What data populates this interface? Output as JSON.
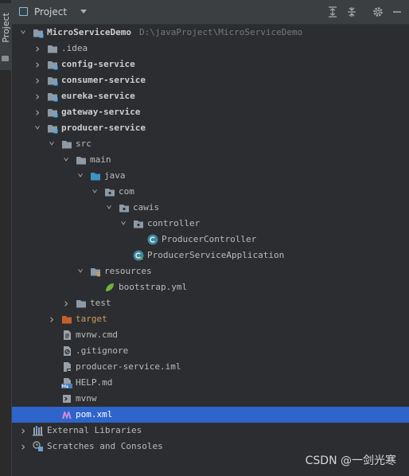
{
  "sidebar": {
    "tab_label": "Project"
  },
  "header": {
    "title": "Project"
  },
  "project_root": {
    "name": "MicroServiceDemo",
    "path": "D:\\javaProject\\MicroServiceDemo"
  },
  "tree": [
    {
      "label": "MicroServiceDemo",
      "depth": 0,
      "expanded": true,
      "icon": "module-folder-icon",
      "bold": true
    },
    {
      "label": ".idea",
      "depth": 1,
      "expanded": false,
      "icon": "folder-icon"
    },
    {
      "label": "config-service",
      "depth": 1,
      "expanded": false,
      "icon": "module-folder-icon",
      "bold": true
    },
    {
      "label": "consumer-service",
      "depth": 1,
      "expanded": false,
      "icon": "module-folder-icon",
      "bold": true
    },
    {
      "label": "eureka-service",
      "depth": 1,
      "expanded": false,
      "icon": "module-folder-icon",
      "bold": true
    },
    {
      "label": "gateway-service",
      "depth": 1,
      "expanded": false,
      "icon": "module-folder-icon",
      "bold": true
    },
    {
      "label": "producer-service",
      "depth": 1,
      "expanded": true,
      "icon": "module-folder-icon",
      "bold": true
    },
    {
      "label": "src",
      "depth": 2,
      "expanded": true,
      "icon": "folder-icon"
    },
    {
      "label": "main",
      "depth": 3,
      "expanded": true,
      "icon": "folder-icon"
    },
    {
      "label": "java",
      "depth": 4,
      "expanded": true,
      "icon": "source-folder-icon"
    },
    {
      "label": "com",
      "depth": 5,
      "expanded": true,
      "icon": "package-icon"
    },
    {
      "label": "cawis",
      "depth": 6,
      "expanded": true,
      "icon": "package-icon"
    },
    {
      "label": "controller",
      "depth": 7,
      "expanded": true,
      "icon": "package-icon"
    },
    {
      "label": "ProducerController",
      "depth": 8,
      "icon": "java-class-icon"
    },
    {
      "label": "ProducerServiceApplication",
      "depth": 7,
      "icon": "spring-boot-class-icon"
    },
    {
      "label": "resources",
      "depth": 4,
      "expanded": true,
      "icon": "resources-folder-icon"
    },
    {
      "label": "bootstrap.yml",
      "depth": 5,
      "icon": "spring-yml-icon"
    },
    {
      "label": "test",
      "depth": 3,
      "expanded": false,
      "icon": "folder-icon"
    },
    {
      "label": "target",
      "depth": 2,
      "expanded": false,
      "icon": "excluded-folder-icon",
      "orange": true
    },
    {
      "label": "mvnw.cmd",
      "depth": 2,
      "icon": "text-file-icon"
    },
    {
      "label": ".gitignore",
      "depth": 2,
      "icon": "gitignore-icon"
    },
    {
      "label": "producer-service.iml",
      "depth": 2,
      "icon": "iml-file-icon"
    },
    {
      "label": "HELP.md",
      "depth": 2,
      "icon": "markdown-file-icon"
    },
    {
      "label": "mvnw",
      "depth": 2,
      "icon": "shell-file-icon"
    },
    {
      "label": "pom.xml",
      "depth": 2,
      "icon": "maven-icon",
      "selected": true
    },
    {
      "label": "External Libraries",
      "depth": 0,
      "expanded": false,
      "icon": "libraries-icon"
    },
    {
      "label": "Scratches and Consoles",
      "depth": 0,
      "expanded": false,
      "icon": "scratches-icon"
    }
  ],
  "colors": {
    "selection": "#2f65ca",
    "folder": "#8e9aa6",
    "module_marker": "#5aa8d8",
    "excluded_folder": "#c3612d",
    "java_class": "#3e86a0"
  },
  "watermark": "CSDN @一剑光寒"
}
